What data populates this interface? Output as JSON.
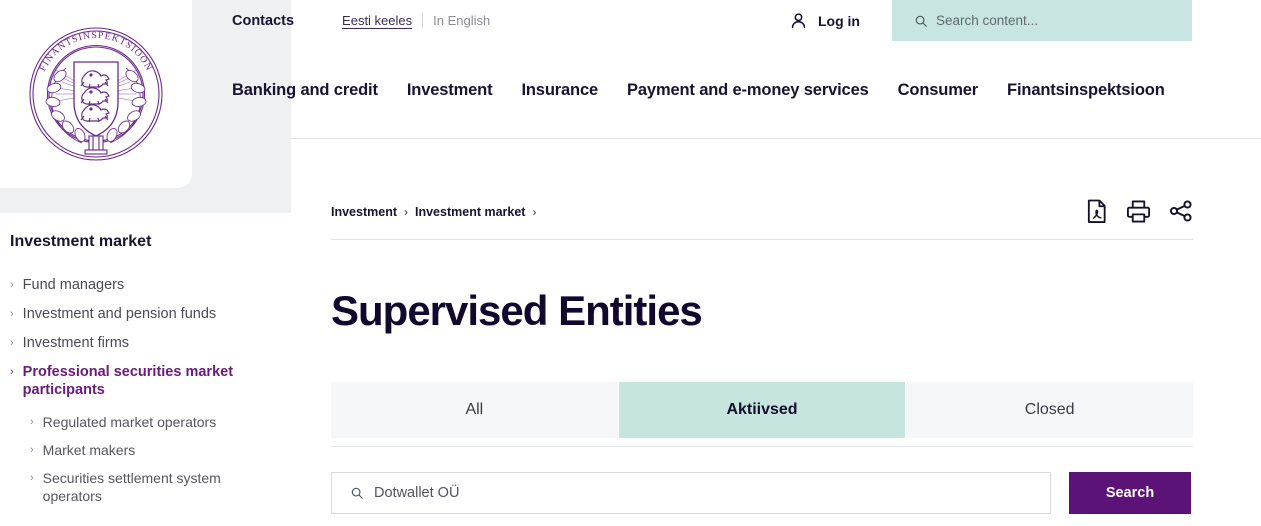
{
  "brand": {
    "logo_text": "FINANTSINSPEKTSIOON",
    "logo_icon": "estonian-coat-of-arms-seal",
    "purple": "#5c1378",
    "mint": "#c6e5df"
  },
  "utility_bar": {
    "contacts_label": "Contacts",
    "lang_active": "Eesti keeles",
    "lang_inactive": "In English",
    "login_label": "Log in",
    "login_icon": "user-icon",
    "search_icon": "search-icon",
    "search_placeholder": "Search content..."
  },
  "main_nav": {
    "items": [
      {
        "label": "Banking and credit"
      },
      {
        "label": "Investment"
      },
      {
        "label": "Insurance"
      },
      {
        "label": "Payment and e-money services"
      },
      {
        "label": "Consumer"
      },
      {
        "label": "Finantsinspektsioon"
      }
    ]
  },
  "sidebar": {
    "title": "Investment market",
    "items": [
      {
        "label": "Fund managers",
        "active": false
      },
      {
        "label": "Investment and pension funds",
        "active": false
      },
      {
        "label": "Investment firms",
        "active": false
      },
      {
        "label": "Professional securities market participants",
        "active": true
      }
    ],
    "sub_items": [
      {
        "label": "Regulated market operators"
      },
      {
        "label": "Market makers"
      },
      {
        "label": "Securities settlement system operators"
      }
    ]
  },
  "breadcrumb": {
    "items": [
      {
        "label": "Investment"
      },
      {
        "label": "Investment market"
      }
    ],
    "separator": "›"
  },
  "action_icons": [
    {
      "name": "pdf-download-icon"
    },
    {
      "name": "print-icon"
    },
    {
      "name": "share-icon"
    }
  ],
  "main": {
    "page_title": "Supervised Entities",
    "tabs": [
      {
        "label": "All",
        "active": false
      },
      {
        "label": "Aktiivsed",
        "active": true
      },
      {
        "label": "Closed",
        "active": false
      }
    ],
    "search": {
      "icon": "search-icon",
      "value": "Dotwallet OÜ",
      "placeholder": "Dotwallet OÜ",
      "button_label": "Search"
    }
  }
}
